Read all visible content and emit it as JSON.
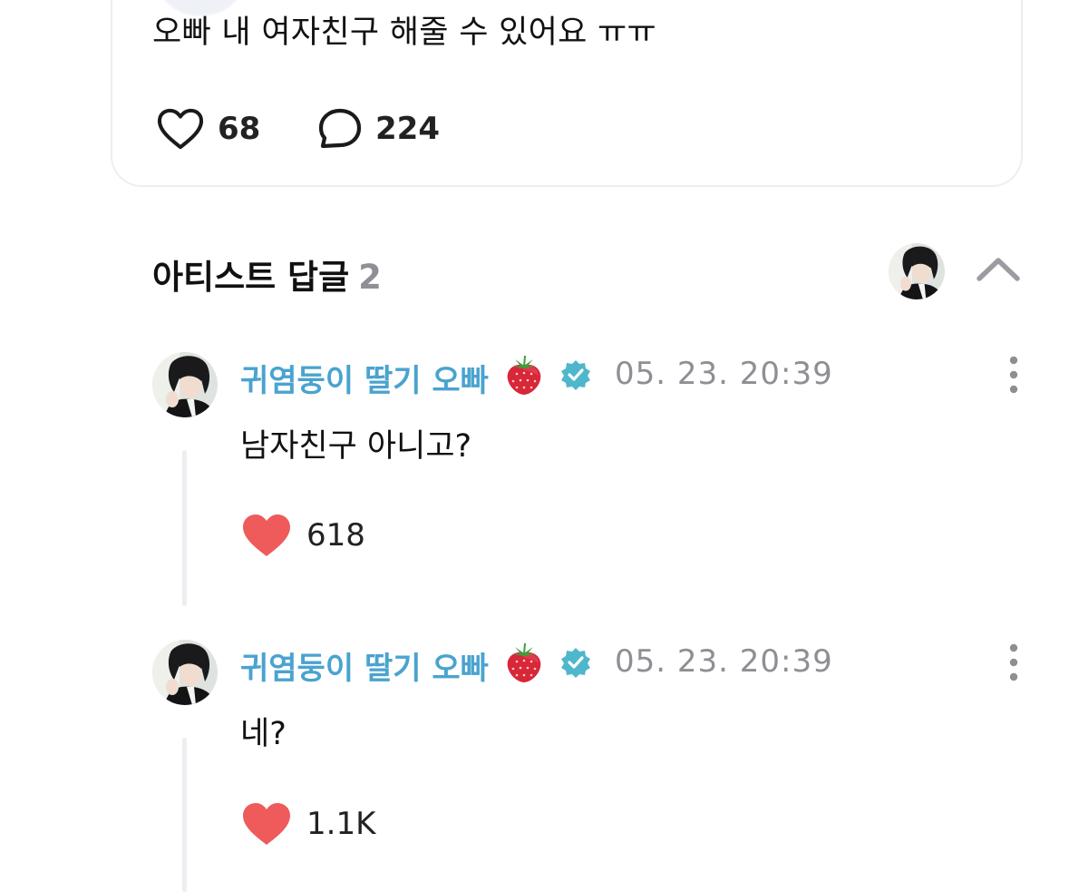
{
  "post": {
    "text": "오빠 내 여자친구 해줄 수 있어요 ㅠㅠ",
    "likes": "68",
    "comments": "224"
  },
  "artist_replies": {
    "title": "아티스트 답글",
    "count": "2",
    "collapse_icon": "chevron-up-icon"
  },
  "replies": [
    {
      "author": "귀염둥이 딸기 오빠",
      "author_emoji": "strawberry",
      "verified": true,
      "time": "05. 23. 20:39",
      "text": "남자친구 아니고?",
      "likes": "618",
      "liked": true
    },
    {
      "author": "귀염둥이 딸기 오빠",
      "author_emoji": "strawberry",
      "verified": true,
      "time": "05. 23. 20:39",
      "text": "네?",
      "likes": "1.1K",
      "liked": true
    }
  ],
  "colors": {
    "accent_name": "#4aa3cf",
    "verified": "#4fb7cc",
    "heart": "#ef5a5a",
    "muted": "#8d8f94",
    "border": "#eceef1"
  }
}
